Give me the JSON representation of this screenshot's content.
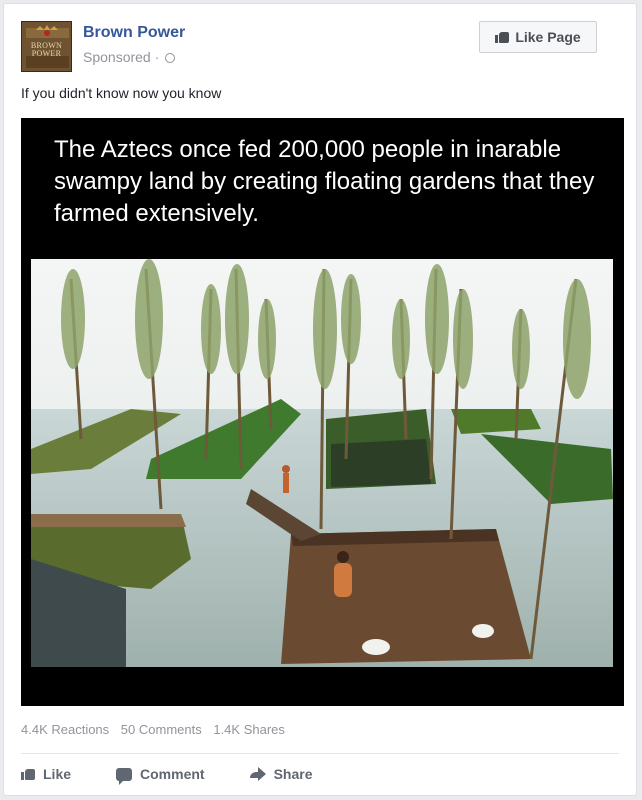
{
  "page": {
    "name": "Brown Power",
    "sponsored": "Sponsored",
    "avatar_text": [
      "BROWN",
      "POWER"
    ]
  },
  "like_page_button": {
    "label": "Like Page"
  },
  "post": {
    "caption": "If you didn't know now you know",
    "image_text": "The Aztecs once fed 200,000 people in inarable swampy land by creating floating gardens that they farmed extensively."
  },
  "stats": {
    "reactions": "4.4K Reactions",
    "comments": "50 Comments",
    "shares": "1.4K Shares"
  },
  "actions": {
    "like": "Like",
    "comment": "Comment",
    "share": "Share"
  },
  "colors": {
    "link_blue": "#365899",
    "meta_grey": "#90949c",
    "action_grey": "#606770"
  }
}
